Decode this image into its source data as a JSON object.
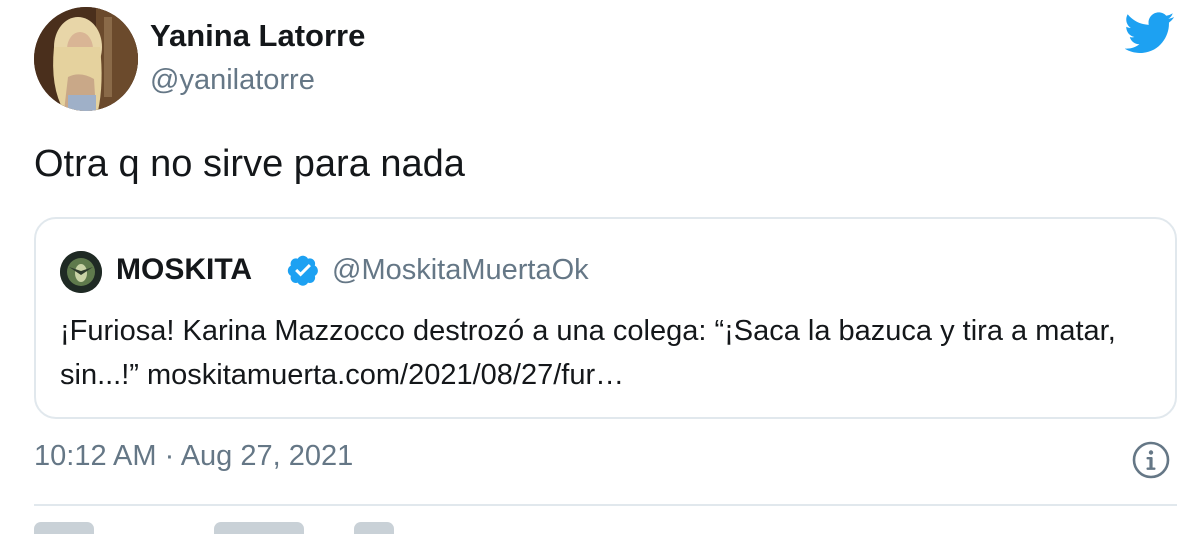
{
  "author": {
    "display_name": "Yanina Latorre",
    "handle": "@yanilatorre",
    "avatar_icon": "profile-photo"
  },
  "brand": {
    "icon": "twitter-bird-icon",
    "color": "#1da1f2"
  },
  "tweet": {
    "text": "Otra q no sirve para nada"
  },
  "quoted_tweet": {
    "display_name": "MOSKITA",
    "verified": true,
    "verified_icon": "verified-badge-icon",
    "handle": "@MoskitaMuertaOk",
    "text": "¡Furiosa! Karina Mazzocco destrozó a una colega: “¡Saca la bazuca y tira a matar, sin...!” moskitamuerta.com/2021/08/27/fur…"
  },
  "meta": {
    "timestamp": "10:12 AM · Aug 27, 2021",
    "info_icon": "info-icon"
  },
  "colors": {
    "text_primary": "#14171a",
    "text_secondary": "#657786",
    "border": "#e1e8ed",
    "accent": "#1da1f2"
  }
}
